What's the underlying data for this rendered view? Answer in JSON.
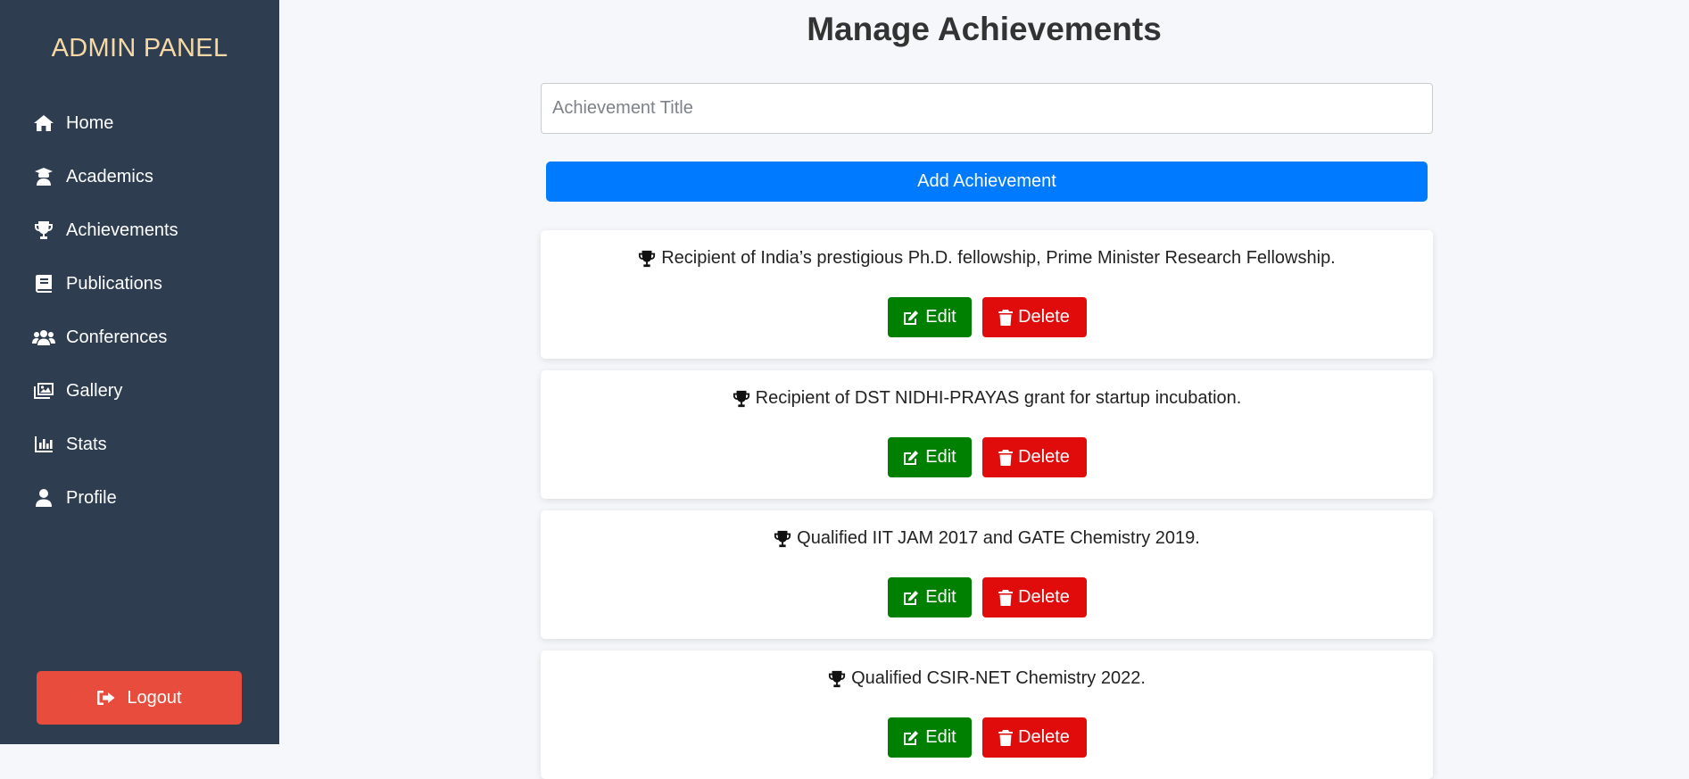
{
  "sidebar": {
    "brand": "ADMIN PANEL",
    "items": [
      {
        "label": "Home",
        "icon": "home-icon"
      },
      {
        "label": "Academics",
        "icon": "graduate-icon"
      },
      {
        "label": "Achievements",
        "icon": "trophy-icon"
      },
      {
        "label": "Publications",
        "icon": "book-icon"
      },
      {
        "label": "Conferences",
        "icon": "users-icon"
      },
      {
        "label": "Gallery",
        "icon": "images-icon"
      },
      {
        "label": "Stats",
        "icon": "chart-bar-icon"
      },
      {
        "label": "Profile",
        "icon": "user-icon"
      }
    ],
    "logout_label": "Logout"
  },
  "main": {
    "title": "Manage Achievements",
    "input_placeholder": "Achievement Title",
    "add_label": "Add Achievement",
    "edit_label": "Edit",
    "delete_label": "Delete",
    "achievements": [
      "Recipient of India’s prestigious Ph.D. fellowship, Prime Minister Research Fellowship.",
      "Recipient of DST NIDHI-PRAYAS grant for startup incubation.",
      "Qualified IIT JAM 2017 and GATE Chemistry 2019.",
      "Qualified CSIR-NET Chemistry 2022."
    ]
  },
  "colors": {
    "sidebar_bg": "#2e3e50",
    "brand": "#f6d9a6",
    "logout": "#e74c3c",
    "primary": "#007bff",
    "edit": "#008000",
    "delete": "#e00b0b"
  }
}
